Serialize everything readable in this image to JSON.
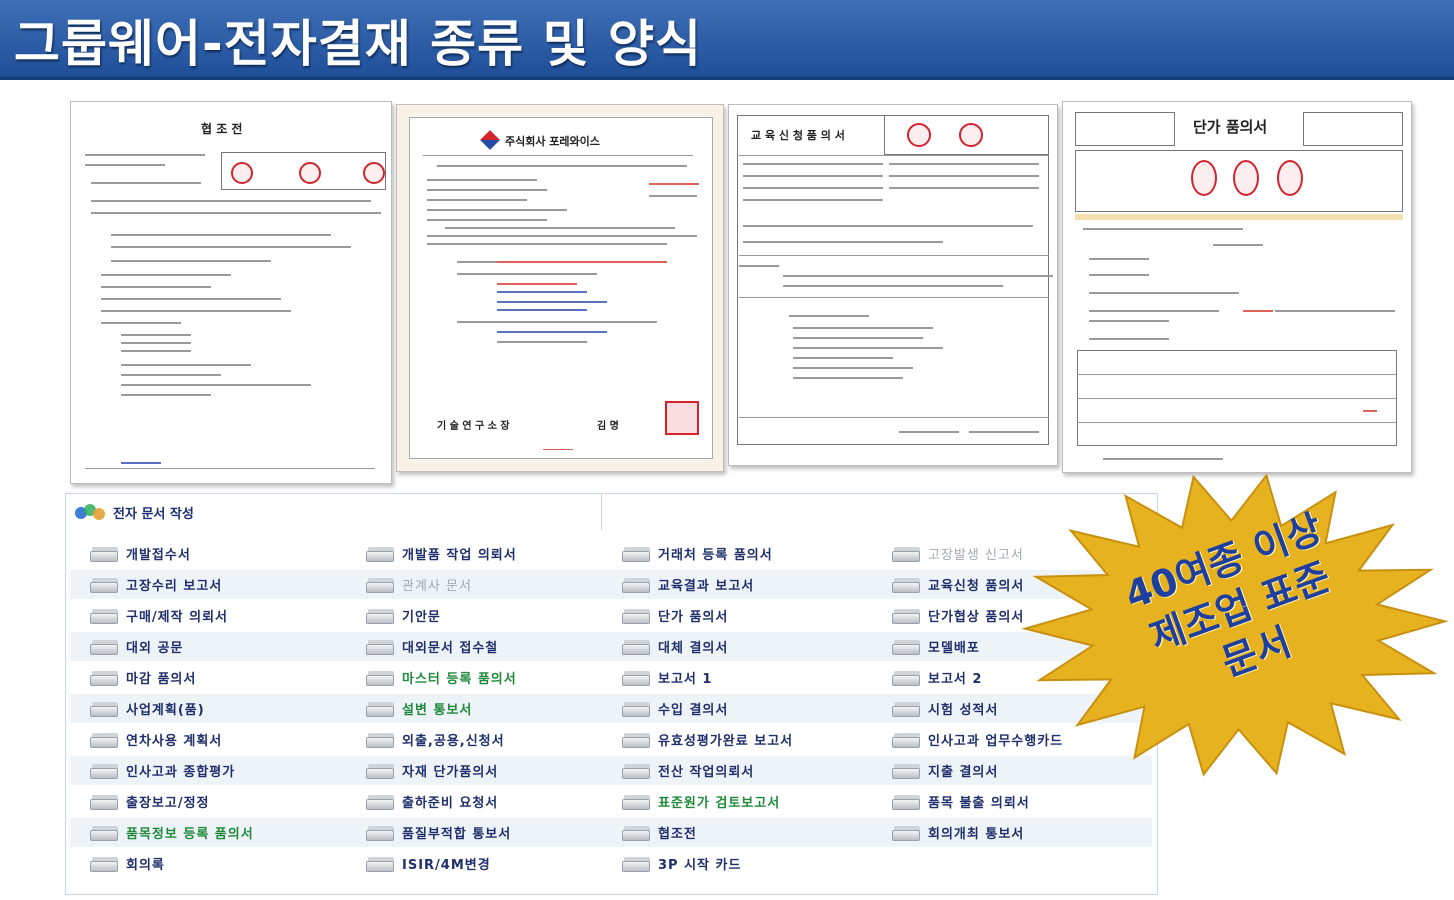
{
  "title": "그룹웨어-전자결재 종류 및 양식",
  "documents": [
    {
      "heading": "협 조 전"
    },
    {
      "company": "주식회사 포레와이스",
      "footer_left": "기 술 연 구 소 장",
      "footer_right": "김 명"
    },
    {
      "heading": "교 육 신 청 품 의 서"
    },
    {
      "heading": "단가 품의서"
    }
  ],
  "panel": {
    "title": "전자 문서 작성",
    "columns": [
      [
        {
          "label": "개발접수서",
          "style": "normal"
        },
        {
          "label": "고장수리 보고서",
          "style": "normal"
        },
        {
          "label": "구매/제작 의뢰서",
          "style": "normal"
        },
        {
          "label": "대외 공문",
          "style": "normal"
        },
        {
          "label": "마감 품의서",
          "style": "normal"
        },
        {
          "label": "사업계획(품)",
          "style": "normal"
        },
        {
          "label": "연차사용 계획서",
          "style": "normal"
        },
        {
          "label": "인사고과 종합평가",
          "style": "normal"
        },
        {
          "label": "출장보고/정정",
          "style": "normal"
        },
        {
          "label": "품목정보 등록 품의서",
          "style": "green"
        },
        {
          "label": "회의록",
          "style": "normal"
        }
      ],
      [
        {
          "label": "개발품 작업 의뢰서",
          "style": "normal"
        },
        {
          "label": "관계사 문서",
          "style": "gray"
        },
        {
          "label": "기안문",
          "style": "normal"
        },
        {
          "label": "대외문서 접수철",
          "style": "normal"
        },
        {
          "label": "마스터 등록 품의서",
          "style": "green"
        },
        {
          "label": "설변 통보서",
          "style": "green"
        },
        {
          "label": "외출,공용,신청서",
          "style": "normal"
        },
        {
          "label": "자재 단가품의서",
          "style": "normal"
        },
        {
          "label": "출하준비 요청서",
          "style": "normal"
        },
        {
          "label": "품질부적합 통보서",
          "style": "normal"
        },
        {
          "label": "ISIR/4M변경",
          "style": "normal"
        }
      ],
      [
        {
          "label": "거래처 등록 품의서",
          "style": "normal"
        },
        {
          "label": "교육결과 보고서",
          "style": "normal"
        },
        {
          "label": "단가 품의서",
          "style": "normal"
        },
        {
          "label": "대체 결의서",
          "style": "normal"
        },
        {
          "label": "보고서 1",
          "style": "normal"
        },
        {
          "label": "수입 결의서",
          "style": "normal"
        },
        {
          "label": "유효성평가완료 보고서",
          "style": "normal"
        },
        {
          "label": "전산 작업의뢰서",
          "style": "normal"
        },
        {
          "label": "표준원가 검토보고서",
          "style": "green"
        },
        {
          "label": "협조전",
          "style": "normal"
        },
        {
          "label": "3P 시작 카드",
          "style": "normal"
        }
      ],
      [
        {
          "label": "고장발생 신고서",
          "style": "gray"
        },
        {
          "label": "교육신청 품의서",
          "style": "normal"
        },
        {
          "label": "단가협상 품의서",
          "style": "normal"
        },
        {
          "label": "모델배포",
          "style": "normal"
        },
        {
          "label": "보고서 2",
          "style": "normal"
        },
        {
          "label": "시험 성적서",
          "style": "normal"
        },
        {
          "label": "인사고과 업무수행카드",
          "style": "normal"
        },
        {
          "label": "지출 결의서",
          "style": "normal"
        },
        {
          "label": "품목 불출 의뢰서",
          "style": "normal"
        },
        {
          "label": "회의개최 통보서",
          "style": "normal"
        }
      ]
    ]
  },
  "badge": {
    "lines": [
      "40여종 이상",
      "제조업 표준",
      "문서"
    ],
    "fill": "#e7b21f",
    "text_color": "#1e3f9e"
  },
  "colors": {
    "title_bar": "#2a5aa5",
    "link": "#1f2f6b",
    "green_link": "#1e8a3a",
    "stamp": "#d3242d"
  }
}
